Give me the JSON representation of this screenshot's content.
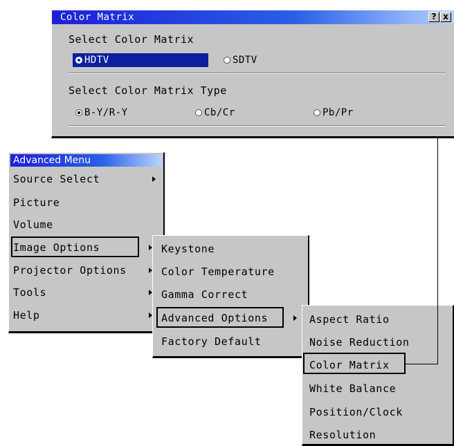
{
  "dialog": {
    "title": "Color Matrix",
    "help_btn": "?",
    "close_btn": "x",
    "group1_label": "Select Color Matrix",
    "matrix_options": [
      "HDTV",
      "SDTV"
    ],
    "group2_label": "Select Color Matrix Type",
    "type_options": [
      "B-Y/R-Y",
      "Cb/Cr",
      "Pb/Pr"
    ]
  },
  "advanced_menu": {
    "title": "Advanced Menu",
    "items": [
      "Source Select",
      "Picture",
      "Volume",
      "Image Options",
      "Projector Options",
      "Tools",
      "Help"
    ]
  },
  "image_options_menu": {
    "items": [
      "Keystone",
      "Color Temperature",
      "Gamma Correct",
      "Advanced Options",
      "Factory Default"
    ]
  },
  "advanced_options_menu": {
    "items": [
      "Aspect Ratio",
      "Noise Reduction",
      "Color Matrix",
      "White Balance",
      "Position/Clock",
      "Resolution"
    ]
  },
  "colors": {
    "panel": "#c6c6c6",
    "titlebar": "#1f1fd6",
    "selection": "#0d1f9c"
  }
}
